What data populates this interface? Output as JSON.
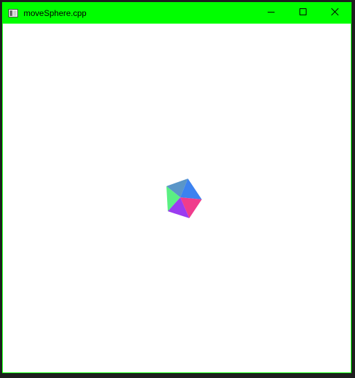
{
  "window": {
    "title": "moveSphere.cpp",
    "title_bar_color": "#00ff00",
    "border_color": "#00ff00",
    "client_background": "#ffffff"
  },
  "titlebar": {
    "app_icon": "window-icon",
    "buttons": [
      {
        "name": "minimize",
        "icon": "minimize-icon"
      },
      {
        "name": "maximize",
        "icon": "maximize-icon"
      },
      {
        "name": "close",
        "icon": "close-icon"
      }
    ]
  },
  "scene": {
    "object": "sphere",
    "face_colors": [
      "#5a96c8",
      "#3c82f0",
      "#f03c8c",
      "#9b3cf0",
      "#5af082"
    ]
  }
}
